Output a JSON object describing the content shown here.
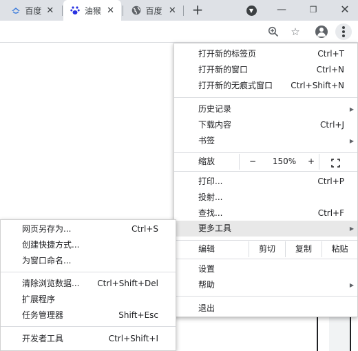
{
  "tabs": [
    {
      "title": "百度",
      "favicon": "baidu-paw-icon"
    },
    {
      "title": "油猴",
      "favicon": "baidu-paw-icon"
    },
    {
      "title": "百度",
      "favicon": "globe-icon"
    }
  ],
  "window": {
    "new_tab": "+",
    "minimize": "—",
    "maximize": "❐",
    "close": "✕"
  },
  "menu": {
    "new_tab": {
      "label": "打开新的标签页",
      "shortcut": "Ctrl+T"
    },
    "new_window": {
      "label": "打开新的窗口",
      "shortcut": "Ctrl+N"
    },
    "incognito": {
      "label": "打开新的无痕式窗口",
      "shortcut": "Ctrl+Shift+N"
    },
    "history": {
      "label": "历史记录"
    },
    "downloads": {
      "label": "下载内容",
      "shortcut": "Ctrl+J"
    },
    "bookmarks": {
      "label": "书签"
    },
    "zoom": {
      "label": "缩放",
      "minus": "−",
      "value": "150%",
      "plus": "+"
    },
    "print": {
      "label": "打印...",
      "shortcut": "Ctrl+P"
    },
    "cast": {
      "label": "投射..."
    },
    "find": {
      "label": "查找...",
      "shortcut": "Ctrl+F"
    },
    "more_tools": {
      "label": "更多工具"
    },
    "edit": {
      "label": "编辑",
      "cut": "剪切",
      "copy": "复制",
      "paste": "粘贴"
    },
    "settings": {
      "label": "设置"
    },
    "help": {
      "label": "帮助"
    },
    "exit": {
      "label": "退出"
    }
  },
  "submenu": {
    "save_page": {
      "label": "网页另存为...",
      "shortcut": "Ctrl+S"
    },
    "create_shortcut": {
      "label": "创建快捷方式..."
    },
    "name_window": {
      "label": "为窗口命名..."
    },
    "clear_data": {
      "label": "清除浏览数据...",
      "shortcut": "Ctrl+Shift+Del"
    },
    "extensions": {
      "label": "扩展程序"
    },
    "task_manager": {
      "label": "任务管理器",
      "shortcut": "Shift+Esc"
    },
    "dev_tools": {
      "label": "开发者工具",
      "shortcut": "Ctrl+Shift+I"
    }
  },
  "colors": {
    "tabstrip": "#dee1e6",
    "menu_highlight": "#e8e8e8",
    "separator": "#dadce0"
  }
}
